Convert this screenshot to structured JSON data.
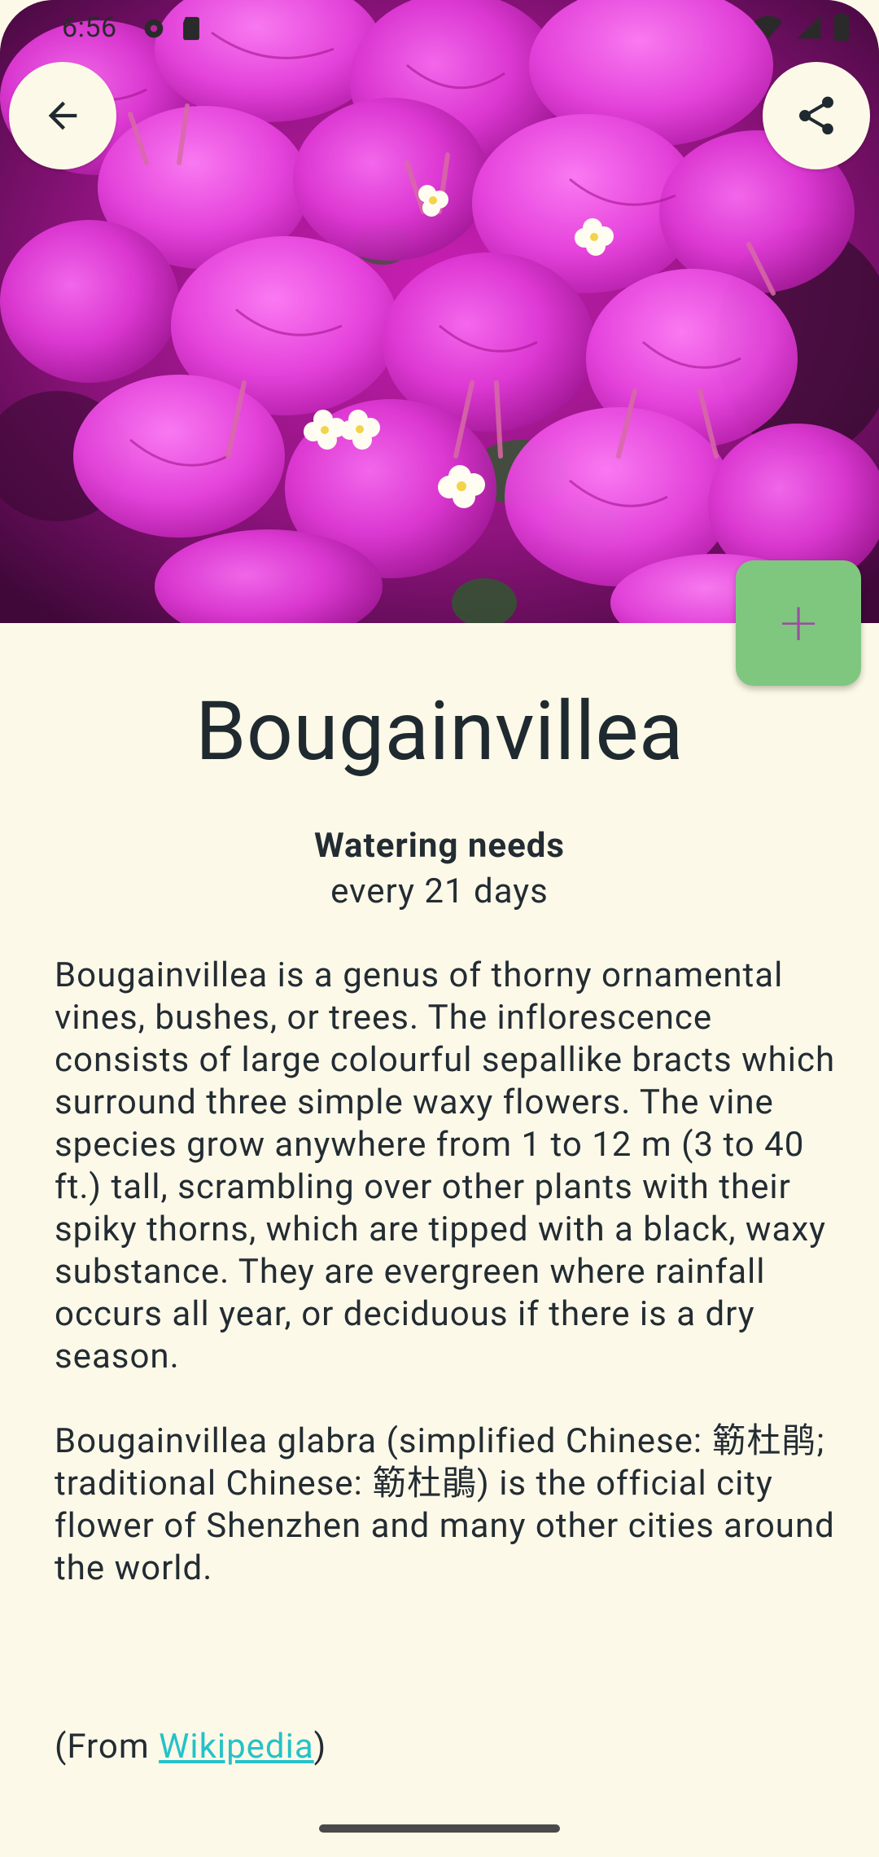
{
  "status_bar": {
    "time": "6:56"
  },
  "nav": {
    "back_icon": "arrow-back-icon",
    "share_icon": "share-icon"
  },
  "fab": {
    "icon": "plus-icon",
    "label": "+"
  },
  "plant": {
    "name": "Bougainvillea",
    "watering_title": "Watering needs",
    "watering_value": "every 21 days",
    "description_p1": "Bougainvillea is a genus of thorny ornamental vines, bushes, or trees. The inflorescence consists of large colourful sepallike bracts which surround three simple waxy flowers. The vine species grow anywhere from 1 to 12 m (3 to 40 ft.) tall, scrambling over other plants with their spiky thorns, which are tipped with a black, waxy substance. They are evergreen where rainfall occurs all year, or deciduous if there is a dry season.",
    "description_p2": "Bougainvillea glabra (simplified Chinese: 簕杜鹃; traditional Chinese: 簕杜鵑) is the official city flower of Shenzhen and many other cities around the world.",
    "source_prefix": "(From ",
    "source_link": "Wikipedia",
    "source_suffix": ")"
  },
  "colors": {
    "background": "#fdf9e8",
    "fab": "#7fc77f",
    "fab_icon": "#9a4fa0",
    "link": "#25c2c8",
    "text": "#232c33"
  }
}
